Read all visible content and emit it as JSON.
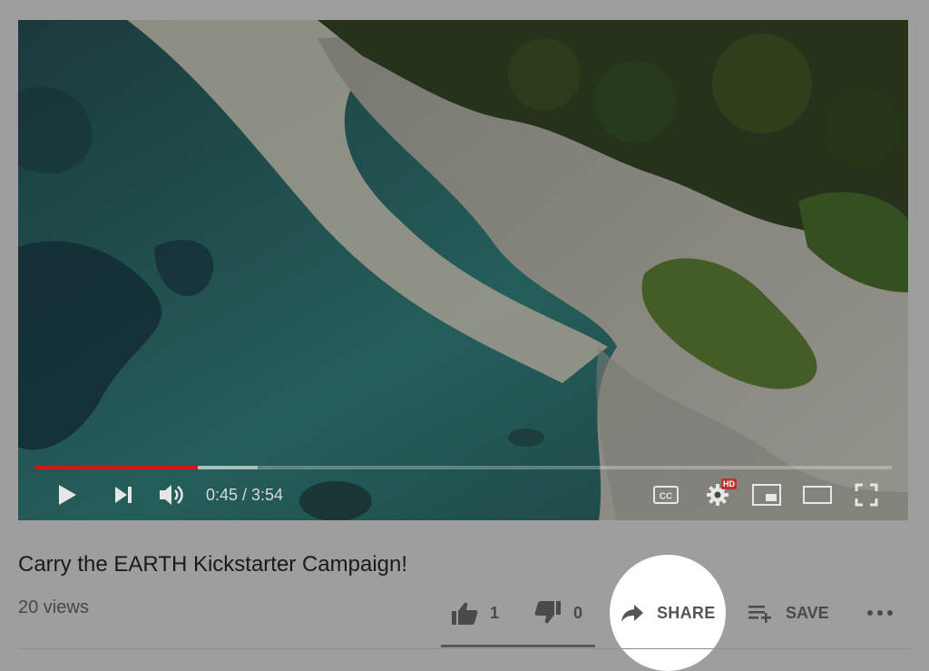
{
  "video": {
    "time_display": "0:45 / 3:54",
    "progress_played": 0.19,
    "progress_buffered": 0.26,
    "progress_color": "#cc181e",
    "hd_badge": "HD"
  },
  "meta": {
    "title": "Carry the EARTH Kickstarter Campaign!",
    "views": "20 views"
  },
  "actions": {
    "like_count": "1",
    "dislike_count": "0",
    "share_label": "SHARE",
    "save_label": "SAVE"
  }
}
